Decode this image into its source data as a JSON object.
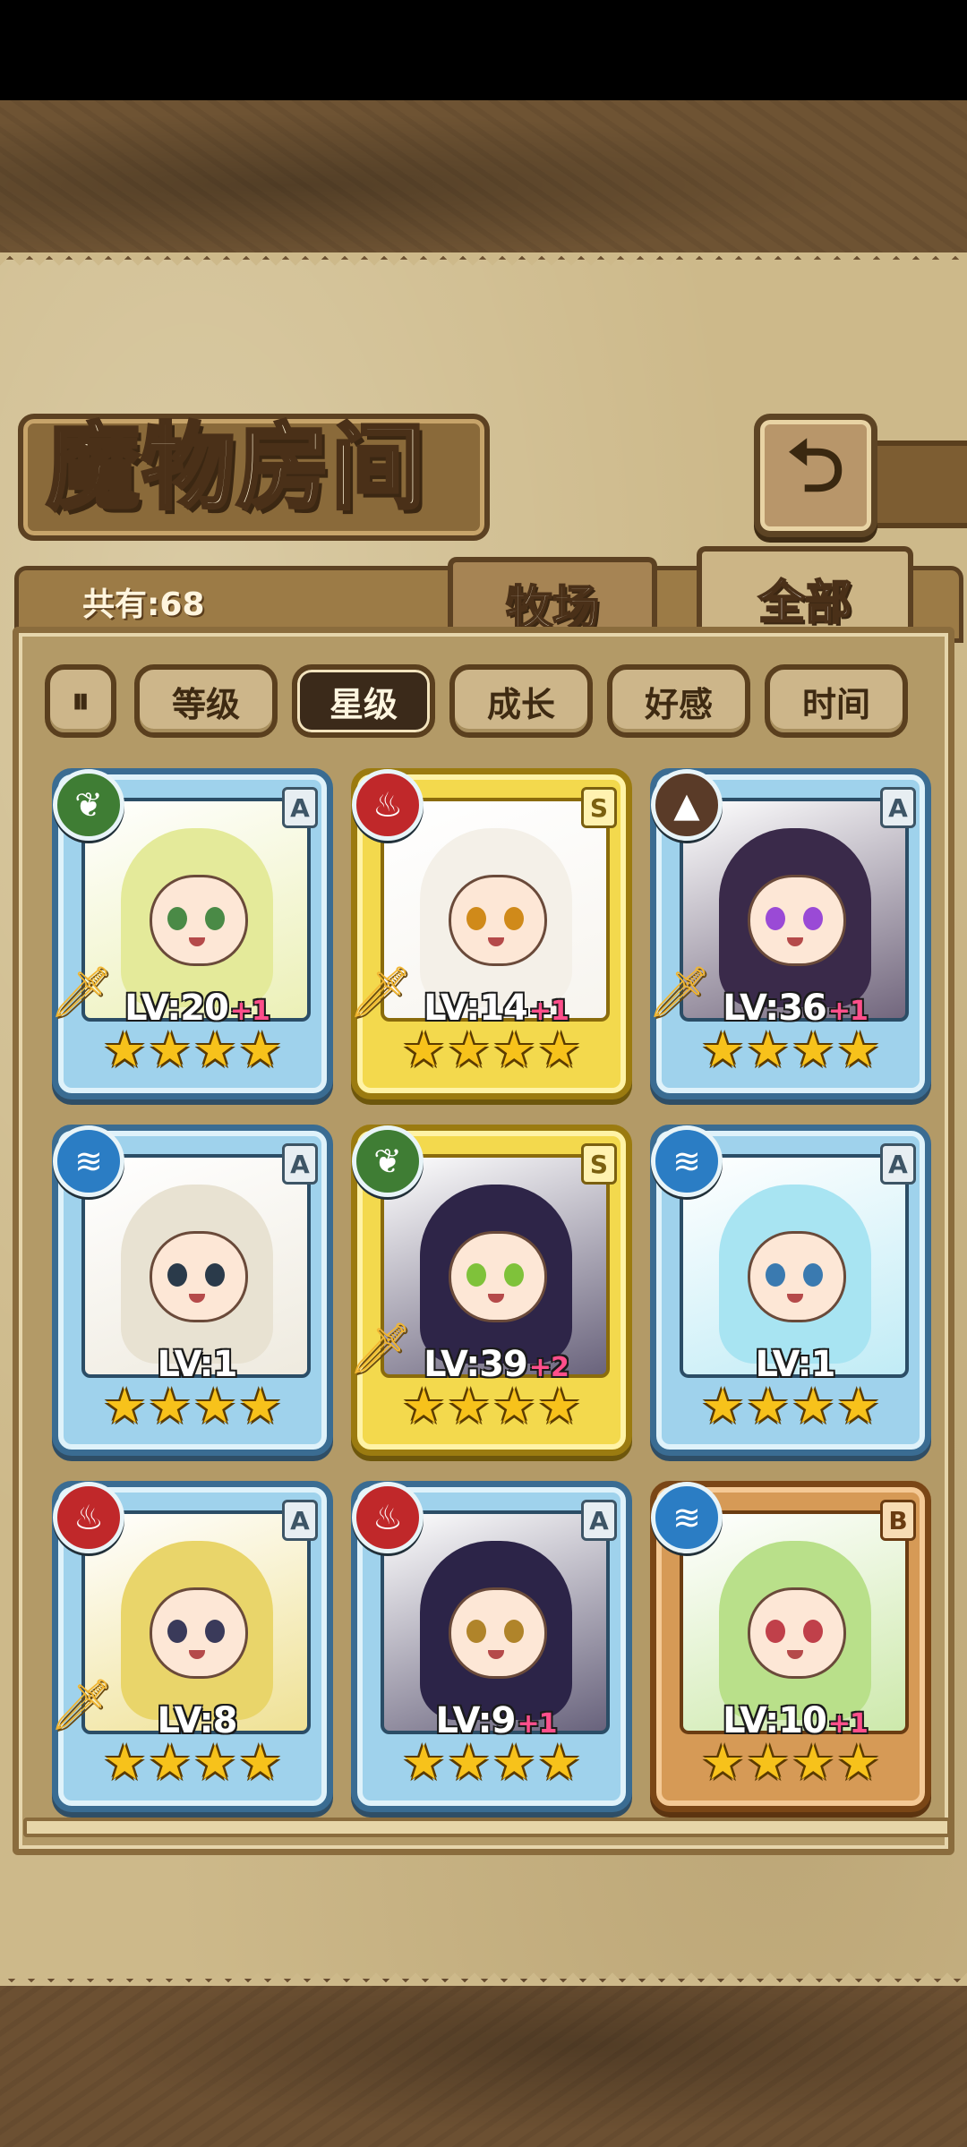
{
  "header": {
    "title": "魔物房间",
    "back_icon": "⮌"
  },
  "tabs": {
    "count_label": "共有:68",
    "ranch": "牧场",
    "all": "全部"
  },
  "sort": {
    "toggle_icon": "⏸",
    "level": "等级",
    "star": "星级",
    "growth": "成长",
    "affection": "好感",
    "time": "时间",
    "active": "星级"
  },
  "monsters": [
    {
      "element": "grass",
      "rank": "A",
      "level": "LV:20",
      "bonus": "+1",
      "stars": 4,
      "frame": "blue",
      "weapon": true
    },
    {
      "element": "fire",
      "rank": "S",
      "level": "LV:14",
      "bonus": "+1",
      "stars": 4,
      "frame": "gold",
      "weapon": true
    },
    {
      "element": "earth",
      "rank": "A",
      "level": "LV:36",
      "bonus": "+1",
      "stars": 4,
      "frame": "blue",
      "weapon": true
    },
    {
      "element": "water",
      "rank": "A",
      "level": "LV:1",
      "bonus": "",
      "stars": 4,
      "frame": "blue",
      "weapon": false
    },
    {
      "element": "grass",
      "rank": "S",
      "level": "LV:39",
      "bonus": "+2",
      "stars": 4,
      "frame": "gold",
      "weapon": true
    },
    {
      "element": "water",
      "rank": "A",
      "level": "LV:1",
      "bonus": "",
      "stars": 4,
      "frame": "blue",
      "weapon": false
    },
    {
      "element": "fire",
      "rank": "A",
      "level": "LV:8",
      "bonus": "",
      "stars": 4,
      "frame": "blue",
      "weapon": true
    },
    {
      "element": "fire",
      "rank": "A",
      "level": "LV:9",
      "bonus": "+1",
      "stars": 4,
      "frame": "blue",
      "weapon": false
    },
    {
      "element": "water",
      "rank": "B",
      "level": "LV:10",
      "bonus": "+1",
      "stars": 4,
      "frame": "bronze",
      "weapon": false
    }
  ],
  "colors": {
    "parchment": "#cdb98a",
    "frame_blue": "#9fd2ec",
    "frame_gold": "#f3d94d",
    "frame_bronze": "#d69a56",
    "star": "#f7c21b",
    "bonus": "#ff4f8b"
  }
}
